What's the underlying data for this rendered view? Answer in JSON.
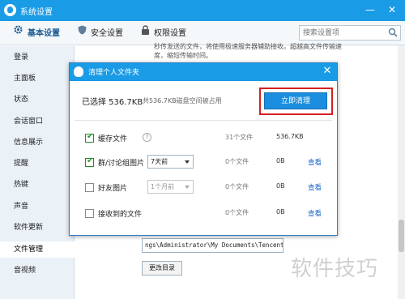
{
  "window": {
    "title": "系统设置",
    "minimize": "—",
    "close": "✕"
  },
  "tabs": [
    {
      "label": "基本设置",
      "active": true
    },
    {
      "label": "安全设置",
      "active": false
    },
    {
      "label": "权限设置",
      "active": false
    }
  ],
  "search": {
    "placeholder": "搜索设置项"
  },
  "sidebar": {
    "items": [
      {
        "label": "登录"
      },
      {
        "label": "主面板"
      },
      {
        "label": "状态"
      },
      {
        "label": "会话窗口"
      },
      {
        "label": "信息展示"
      },
      {
        "label": "提醒"
      },
      {
        "label": "热键"
      },
      {
        "label": "声音"
      },
      {
        "label": "软件更新"
      },
      {
        "label": "文件管理",
        "active": true
      },
      {
        "label": "音视频"
      }
    ]
  },
  "background": {
    "line1": "秒传发送的文件，将使用极速服务器辅助接收。超越高文件传输速",
    "line2": "度，缩短传输时间。",
    "path_value": "ngs\\Administrator\\My Documents\\Tencent",
    "change_dir": "更改目录",
    "watermark": "软件技巧"
  },
  "dialog": {
    "title": "清理个人文件夹",
    "close": "✕",
    "selected_label": "已选择 536.7KB",
    "selected_sub": "共536.7KB磁盘空间被占用",
    "clean_button": "立即清理",
    "rows": [
      {
        "label": "缓存文件",
        "checked": true,
        "help": "?",
        "count": "31个文件",
        "size": "536.7KB",
        "action": ""
      },
      {
        "label": "群/讨论组图片",
        "checked": true,
        "select": "7天前",
        "count": "0个文件",
        "size": "0B",
        "action": "查看"
      },
      {
        "label": "好友图片",
        "checked": false,
        "select": "1个月前",
        "count": "0个文件",
        "size": "0B",
        "action": "查看"
      },
      {
        "label": "接收到的文件",
        "checked": false,
        "count": "0个文件",
        "size": "0B",
        "action": "查看"
      }
    ]
  },
  "colors": {
    "accent": "#1a9be6",
    "highlight": "#d42020",
    "link": "#1a66cc"
  }
}
